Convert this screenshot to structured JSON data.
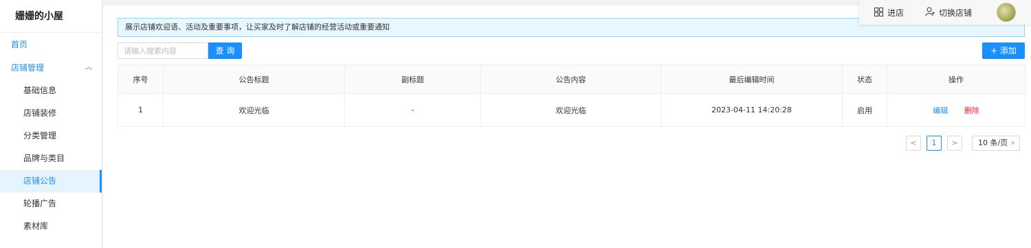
{
  "sidebar": {
    "brand": "姗姗的小屋",
    "home": "首页",
    "store_management": "店铺管理",
    "items": [
      "基础信息",
      "店铺装修",
      "分类管理",
      "品牌与类目",
      "店铺公告",
      "轮播广告",
      "素材库"
    ],
    "active_index": 4
  },
  "header": {
    "enter_store": "进店",
    "switch_store": "切换店铺"
  },
  "notice": "展示店铺欢迎语、活动及重要事项，让买家及时了解店铺的经营活动或重要通知",
  "toolbar": {
    "search_placeholder": "请输入搜索内容",
    "search_label": "查 询",
    "add_label": "+ 添加"
  },
  "table": {
    "columns": [
      "序号",
      "公告标题",
      "副标题",
      "公告内容",
      "最后编辑时间",
      "状态",
      "操作"
    ],
    "rows": [
      {
        "index": "1",
        "title": "欢迎光临",
        "subtitle": "-",
        "content": "欢迎光临",
        "edited_at": "2023-04-11 14:20:28",
        "status": "启用",
        "edit": "编辑",
        "delete": "删除"
      }
    ]
  },
  "pagination": {
    "prev": "<",
    "current": "1",
    "next": ">",
    "page_size": "10 条/页"
  },
  "colors": {
    "primary": "#1890ff",
    "success": "#52c41a",
    "danger": "#f5222d",
    "notice_bg": "#e6f7ff"
  }
}
